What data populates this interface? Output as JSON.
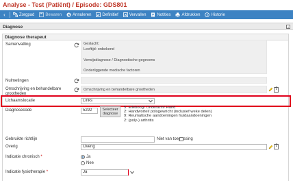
{
  "window": {
    "title": "Analyse - Test (Patiënt) / Episode: GDS801"
  },
  "toolbar": {
    "items": [
      {
        "label": "Zorgpad",
        "icon": "pathway-icon"
      },
      {
        "label": "Bewaren",
        "icon": "save-icon",
        "disabled": true
      },
      {
        "label": "Annuleren",
        "icon": "cancel-icon"
      },
      {
        "label": "Definitief",
        "icon": "check-icon"
      },
      {
        "label": "Vervallen",
        "icon": "expire-icon"
      },
      {
        "label": "Notities",
        "icon": "notes-icon"
      },
      {
        "label": "Afdrukken",
        "icon": "print-icon"
      },
      {
        "label": "Historie",
        "icon": "history-icon"
      }
    ]
  },
  "panel": {
    "title": "Diagnose"
  },
  "section": {
    "title": "Diagnose therapeut"
  },
  "form": {
    "samenvatting": {
      "label": "Samenvatting",
      "lines": [
        "Geslacht:",
        "Leeftijd:  onbekend",
        "Verwijsdiagnose / Diagnostische gegevens",
        "Onderliggende medische factoren"
      ]
    },
    "nulmetingen": {
      "label": "Nulmetingen"
    },
    "omschrijving": {
      "label": "Omschrijving en behandelbare grootheden",
      "value": "Omschrijving en behandelbare grootheden"
    },
    "lichaamslocatie": {
      "label": "Lichaamslocatie",
      "value": "Links"
    },
    "diagnosecode": {
      "label": "Diagnosecode",
      "code": "5292",
      "button_label": "Selecteer diagnose",
      "list": [
        "5: Elleboog/ Onderarm/ Hand",
        "2: Handwortel/ polsgewricht (inclusief weke delen)",
        "9: Reumatische aandoeningen huidaandoeningen",
        "2: (poly-) arthritis"
      ]
    },
    "richtlijn": {
      "label": "Gebruikte richtlijn",
      "nvt_label": "Niet van toepassing"
    },
    "overig": {
      "label": "Overig",
      "value": "Overig"
    },
    "chronisch": {
      "label": "Indicatie chronisch",
      "required_mark": "*",
      "options": [
        "Ja",
        "Nee"
      ],
      "selected": "Ja"
    },
    "fysiotherapie": {
      "label": "Indicatie fysiotherapie",
      "required_mark": "*",
      "value": "Ja"
    }
  },
  "colors": {
    "toolbar": "#3d83c3",
    "title": "#c0392b",
    "highlight": "#e0001b"
  }
}
